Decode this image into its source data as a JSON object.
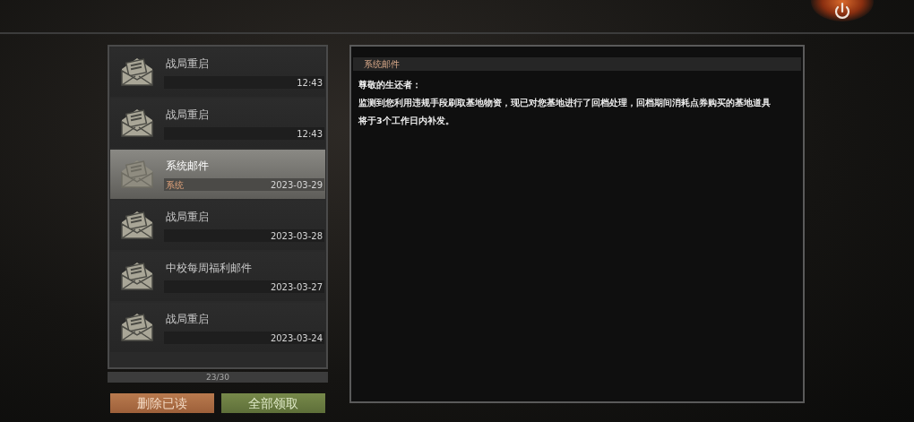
{
  "mails": [
    {
      "title": "战局重启",
      "time": "12:43",
      "selected": false
    },
    {
      "title": "战局重启",
      "time": "12:43",
      "selected": false
    },
    {
      "title": "系统邮件",
      "sender": "系统",
      "time": "2023-03-29",
      "selected": true
    },
    {
      "title": "战局重启",
      "time": "2023-03-28",
      "selected": false
    },
    {
      "title": "中校每周福利邮件",
      "time": "2023-03-27",
      "selected": false
    },
    {
      "title": "战局重启",
      "time": "2023-03-24",
      "selected": false
    }
  ],
  "counter": "23/30",
  "buttons": [
    {
      "kind": "delete",
      "label": "删除已读"
    },
    {
      "kind": "claim",
      "label": "全部领取"
    }
  ],
  "detail": {
    "header": "系统邮件",
    "greeting": "尊敬的生还者：",
    "body": "监测到您利用违规手段刷取基地物资，现已对您基地进行了回档处理，回档期间消耗点券购买的基地道具将于3个工作日内补发。"
  }
}
